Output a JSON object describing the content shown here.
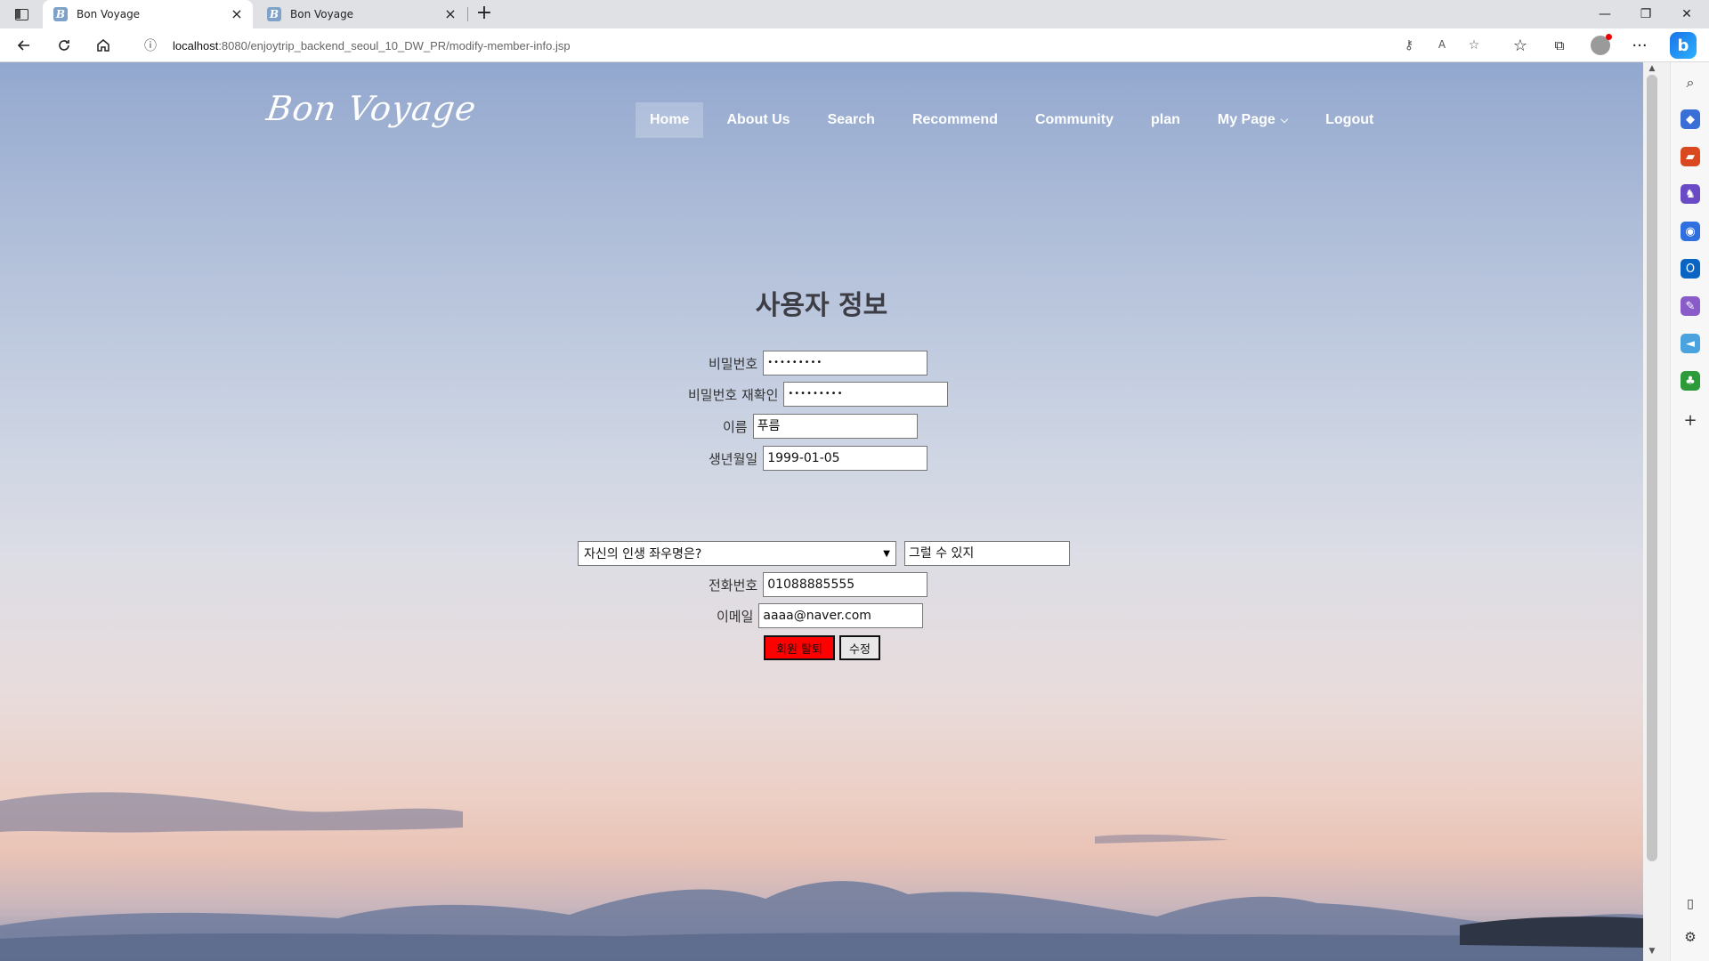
{
  "browser": {
    "tabs": [
      {
        "title": "Bon Voyage",
        "favicon": "B"
      },
      {
        "title": "Bon Voyage",
        "favicon": "B"
      }
    ],
    "new_tab_symbol": "+",
    "close_symbol": "×",
    "window": {
      "minimize": "—",
      "restore": "❐",
      "close": "✕"
    },
    "url": {
      "host": "localhost",
      "rest": ":8080/enjoytrip_backend_seoul_10_DW_PR/modify-member-info.jsp"
    },
    "copilot_label": "b"
  },
  "site": {
    "brand": "Bon Voyage",
    "nav": [
      {
        "label": "Home"
      },
      {
        "label": "About Us"
      },
      {
        "label": "Search"
      },
      {
        "label": "Recommend"
      },
      {
        "label": "Community"
      },
      {
        "label": "plan"
      },
      {
        "label": "My Page"
      },
      {
        "label": "Logout"
      }
    ],
    "dropdown_symbol": "⌵"
  },
  "form": {
    "title": "사용자 정보",
    "password": {
      "label": "비밀번호",
      "value": "•••••••••"
    },
    "password_confirm": {
      "label": "비밀번호 재확인",
      "value": "•••••••••"
    },
    "name": {
      "label": "이름",
      "value": "푸름"
    },
    "birth": {
      "label": "생년월일",
      "value": "1999-01-05"
    },
    "question": {
      "selected": "자신의 인생 좌우명은?"
    },
    "answer": {
      "value": "그럴 수 있지"
    },
    "phone": {
      "label": "전화번호",
      "value": "01088885555"
    },
    "email": {
      "label": "이메일",
      "value": "aaaa@naver.com"
    },
    "withdraw_button": "회원 탈퇴",
    "modify_button": "수정"
  },
  "colors": {
    "withdraw_button_bg": "#ff0000",
    "nav_active_bg": "rgba(255,255,255,0.22)"
  }
}
